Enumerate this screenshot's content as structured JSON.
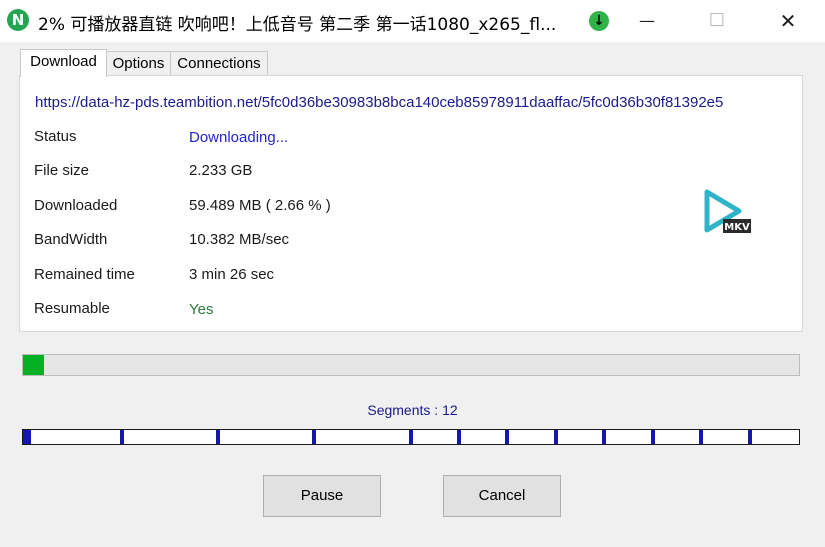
{
  "window": {
    "title": "2%  可播放器直链 吹响吧！上低音号 第二季 第一话1080_x265_fl...",
    "app_icon_glyph": "N",
    "app_icon": "app-logo-icon",
    "download_badge_icon": "download-arrow-icon",
    "download_badge_glyph": "↓",
    "minimize_glyph": "—",
    "maximize_glyph": "☐",
    "close_glyph": "✕"
  },
  "tabs": [
    {
      "label": "Download",
      "active": true
    },
    {
      "label": "Options",
      "active": false
    },
    {
      "label": "Connections",
      "active": false
    }
  ],
  "download": {
    "url": "https://data-hz-pds.teambition.net/5fc0d36be30983b8bca140ceb85978911daaffac/5fc0d36b30f81392e5",
    "rows": [
      {
        "label": "Status",
        "value": "Downloading..."
      },
      {
        "label": "File size",
        "value": "2.233  GB"
      },
      {
        "label": "Downloaded",
        "value": "59.489  MB  ( 2.66 % )"
      },
      {
        "label": "BandWidth",
        "value": "10.382  MB/sec"
      },
      {
        "label": "Remained time",
        "value": "3 min  26 sec"
      },
      {
        "label": "Resumable",
        "value": "Yes"
      }
    ],
    "file_type_icon": "mkv-video-file-icon",
    "file_type_label": "MKV"
  },
  "progress": {
    "fraction": 0.0266
  },
  "segments": {
    "label": "Segments : 12",
    "count": 12,
    "boundaries": [
      0.126,
      0.25,
      0.374,
      0.499,
      0.561,
      0.623,
      0.685,
      0.748,
      0.81,
      0.873,
      0.935,
      1.0
    ],
    "progress": [
      0.2,
      0.0,
      0.0,
      0.0,
      0.0,
      0.0,
      0.0,
      0.0,
      0.0,
      0.0,
      0.0,
      0.0
    ]
  },
  "buttons": {
    "pause_label": "Pause",
    "cancel_label": "Cancel"
  },
  "colors": {
    "progress_fill": "#06b025",
    "segment_fill": "#1515b8",
    "status_text": "#2323c8",
    "resumable_text": "#2a7a3a",
    "url_text": "#1a1a8c",
    "mkv_icon_teal": "#2fb3c8"
  }
}
